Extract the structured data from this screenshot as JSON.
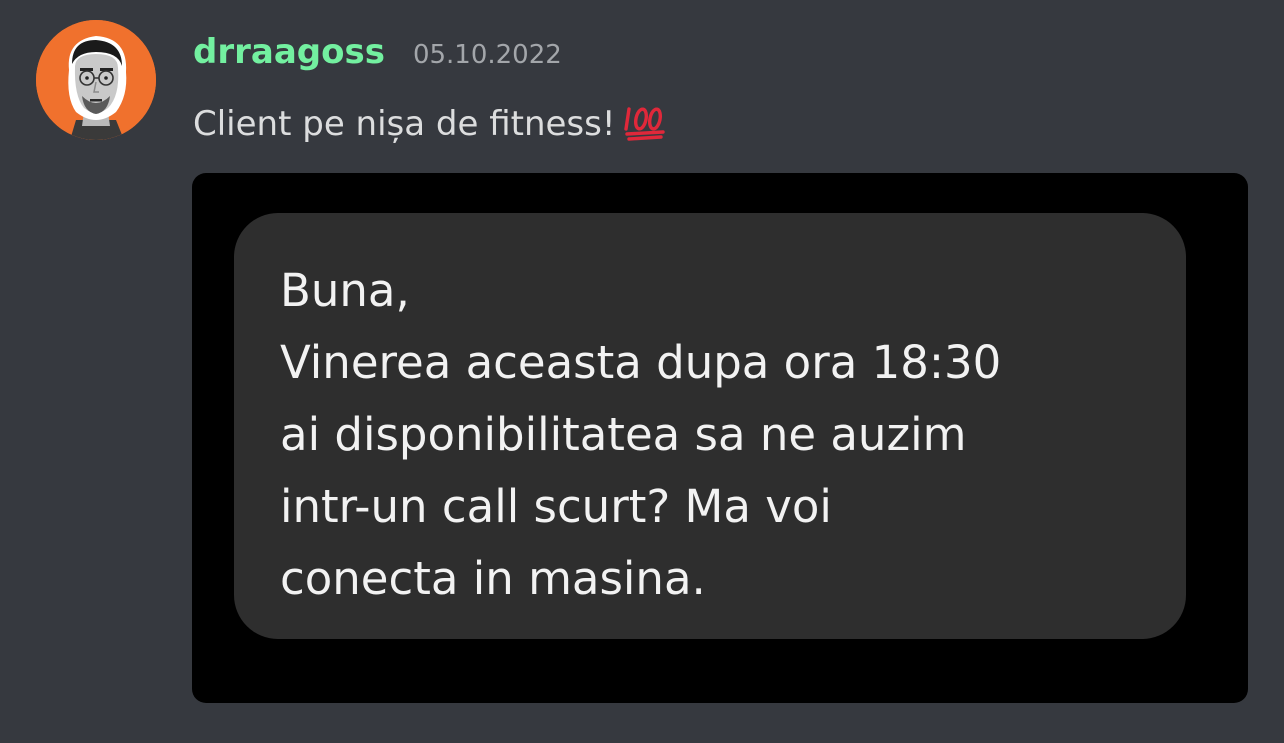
{
  "message": {
    "author": "drraagoss",
    "timestamp": "05.10.2022",
    "text": "Client pe nișa de fitness!",
    "emoji": "hundred-points",
    "author_color": "#73f0a0",
    "avatar_bg": "#f0712d"
  },
  "attachment": {
    "sms_lines": [
      "Buna,",
      "Vinerea aceasta dupa ora 18:30",
      "ai disponibilitatea sa ne auzim",
      "intr-un call scurt? Ma voi",
      "conecta in masina."
    ]
  },
  "theme": {
    "background": "#36393f",
    "text": "#dcddde",
    "muted": "#a3a6aa"
  }
}
